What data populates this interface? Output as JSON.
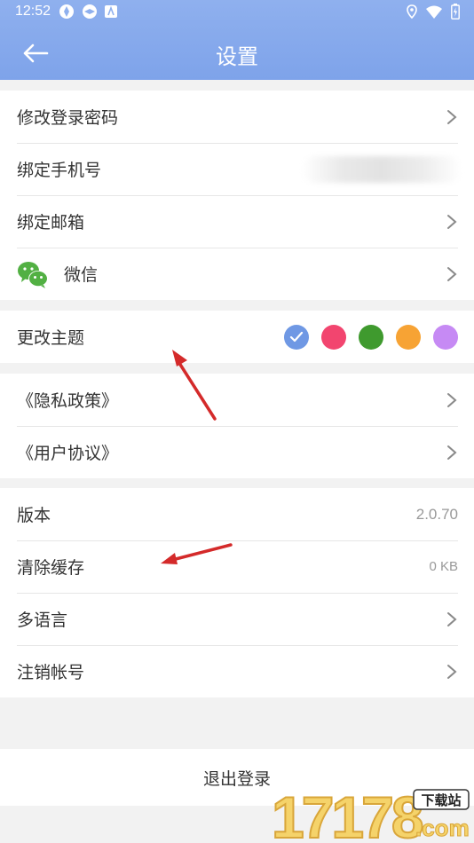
{
  "status_bar": {
    "time": "12:52"
  },
  "header": {
    "title": "设置"
  },
  "groups": {
    "account": [
      {
        "label": "修改登录密码"
      },
      {
        "label": "绑定手机号"
      },
      {
        "label": "绑定邮箱"
      },
      {
        "label": "微信"
      }
    ],
    "theme": {
      "label": "更改主题",
      "colors": [
        "#6f98e4",
        "#f2456f",
        "#3f9a2e",
        "#f7a334",
        "#c68af4"
      ],
      "selected_index": 0
    },
    "policies": [
      {
        "label": "《隐私政策》"
      },
      {
        "label": "《用户协议》"
      }
    ],
    "misc": [
      {
        "label": "版本",
        "value": "2.0.70"
      },
      {
        "label": "清除缓存",
        "value": "0 KB"
      },
      {
        "label": "多语言"
      },
      {
        "label": "注销帐号"
      }
    ]
  },
  "logout_label": "退出登录",
  "watermark": {
    "number": "17178",
    "tag": "下载站",
    "domain": ".com"
  },
  "colors": {
    "header": "#8aaced",
    "annotation_arrow": "#d42a2a"
  }
}
